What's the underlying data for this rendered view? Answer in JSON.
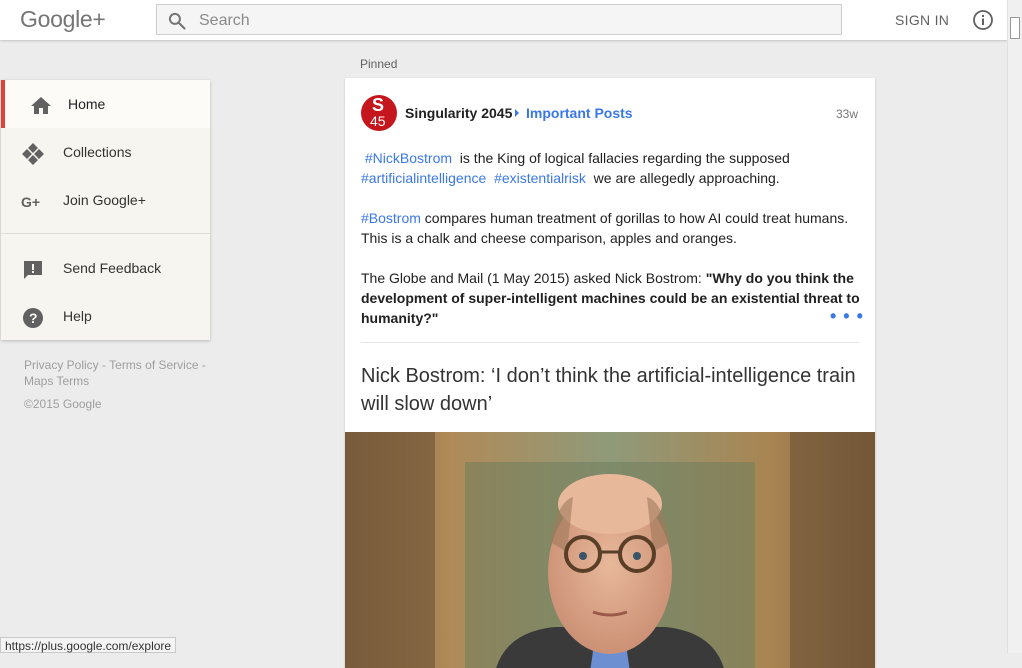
{
  "header": {
    "logo": "Google+",
    "search_placeholder": "Search",
    "sign_in": "SIGN IN"
  },
  "nav": {
    "items": [
      {
        "label": "Home",
        "icon": "home-icon",
        "active": true
      },
      {
        "label": "Collections",
        "icon": "collections-icon"
      },
      {
        "label": "Join Google+",
        "icon": "google-plus-icon"
      },
      {
        "label": "Send Feedback",
        "icon": "feedback-icon"
      },
      {
        "label": "Help",
        "icon": "help-icon"
      }
    ]
  },
  "footer": {
    "privacy": "Privacy Policy",
    "terms": "Terms of Service",
    "maps_terms": "Maps Terms",
    "sep": " - ",
    "copyright": "©2015 Google"
  },
  "post": {
    "pinned": "Pinned",
    "avatar_top": "S",
    "avatar_bottom": "45",
    "author": "Singularity 2045",
    "collection": "Important Posts",
    "time": "33w",
    "p1_tag1": "#NickBostrom",
    "p1_text1": " is the King of logical fallacies regarding the supposed ",
    "p1_tag2": "#artificialintelligence",
    "p1_tag3": "#existentialrisk",
    "p1_text2": " we are allegedly approaching.",
    "p2_tag": "#Bostrom",
    "p2_text": " compares human treatment of gorillas to how AI could treat humans. This is a chalk and cheese comparison, apples and oranges.",
    "p3_text": "The Globe and Mail (1 May 2015) asked Nick Bostrom: ",
    "p3_bold": "\"Why do you think the development of super-intelligent machines could be an existential threat to humanity?\"",
    "more": "• • •",
    "link_title": "Nick Bostrom: ‘I don’t think the artificial-intelligence train will slow down’"
  },
  "status_url": "https://plus.google.com/explore",
  "colors": {
    "accent_red": "#db4437",
    "link_blue": "#3b78e7"
  }
}
